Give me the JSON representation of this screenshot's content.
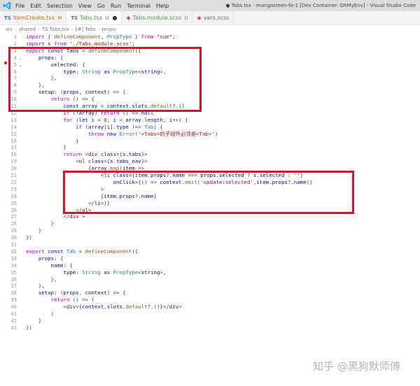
{
  "menu": [
    "File",
    "Edit",
    "Selection",
    "View",
    "Go",
    "Run",
    "Terminal",
    "Help"
  ],
  "window_title": "● Tabs.tsx - mangosteen-fe-1 [Dev Container: OhMyEnv] - Visual Studio Code",
  "tabs": [
    {
      "icon": "TS",
      "label": "ItemCreate.tsx",
      "flag": "M"
    },
    {
      "icon": "TS",
      "label": "Tabs.tsx",
      "flag": "U",
      "dirty": "●"
    },
    {
      "icon": "◆",
      "label": "Tabs.module.scss",
      "flag": "U"
    },
    {
      "icon": "◆",
      "label": "vars.scss",
      "flag": ""
    }
  ],
  "breadcrumb": [
    "src",
    "shared",
    "TS Tabs.tsx",
    "[#] Tabs",
    "props"
  ],
  "code_lines": [
    "import { defineComponent, PropType } from \"vue\";",
    "import s from './Tabs.module.scss';",
    "export const Tabs = defineComponent({",
    "    props: {",
    "        selected: {",
    "            type: String as PropType<string>,",
    "        },",
    "    },",
    "    setup: (props, context) => {",
    "        return () => {",
    "            const array = context.slots.default?.()",
    "            if (!array) return () => null",
    "            for (let i = 0; i < array.length; i++) {",
    "                if (array[i].type !== Tab) {",
    "                    throw new Error('<Tabs>的子组件必须是<Tab>')",
    "                }",
    "            }",
    "            return <div class={s.tabs}>",
    "                <ol class={s.tabs_nav}>",
    "                    {array.map(item =>",
    "                        <li class={item.props?.name === props.selected ? s.selected : ''}",
    "                            onClick={() => context.emit('update:selected',item.props?.name)}",
    "                        >",
    "                        {item.props?.name}",
    "                    </li>)}",
    "                </ol>",
    "            </div >",
    "        }",
    "    }",
    "})",
    "",
    "export const Tab = defineComponent({",
    "    props: {",
    "        name: {",
    "            type: String as PropType<string>,",
    "        },",
    "    },",
    "    setup: (props, context) => {",
    "        return () => (",
    "            <div>{context.slots.default?.()}</div>",
    "        )",
    "    }",
    "})"
  ],
  "watermark": "知乎 @黑狗默师傅"
}
